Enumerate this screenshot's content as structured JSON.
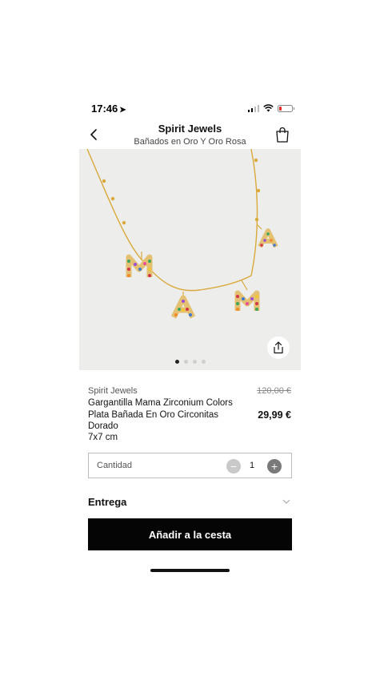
{
  "status": {
    "time": "17:46",
    "location_arrow": "➤"
  },
  "header": {
    "title": "Spirit Jewels",
    "subtitle": "Bañados en Oro Y Oro Rosa"
  },
  "gallery": {
    "pages": 4,
    "active_page": 1
  },
  "product": {
    "brand": "Spirit Jewels",
    "name": "Gargantilla Mama Zirconium Colors Plata Bañada En Oro Circonitas Dorado",
    "size": "7x7 cm",
    "old_price": "120,00 €",
    "price": "29,99 €"
  },
  "quantity": {
    "label": "Cantidad",
    "value": "1",
    "minus": "−",
    "plus": "+"
  },
  "entrega": {
    "label": "Entrega"
  },
  "cta": {
    "label": "Añadir a la cesta"
  },
  "colors": {
    "gold": "#d9a93a",
    "button": "#050505",
    "image_bg": "#ededec"
  }
}
